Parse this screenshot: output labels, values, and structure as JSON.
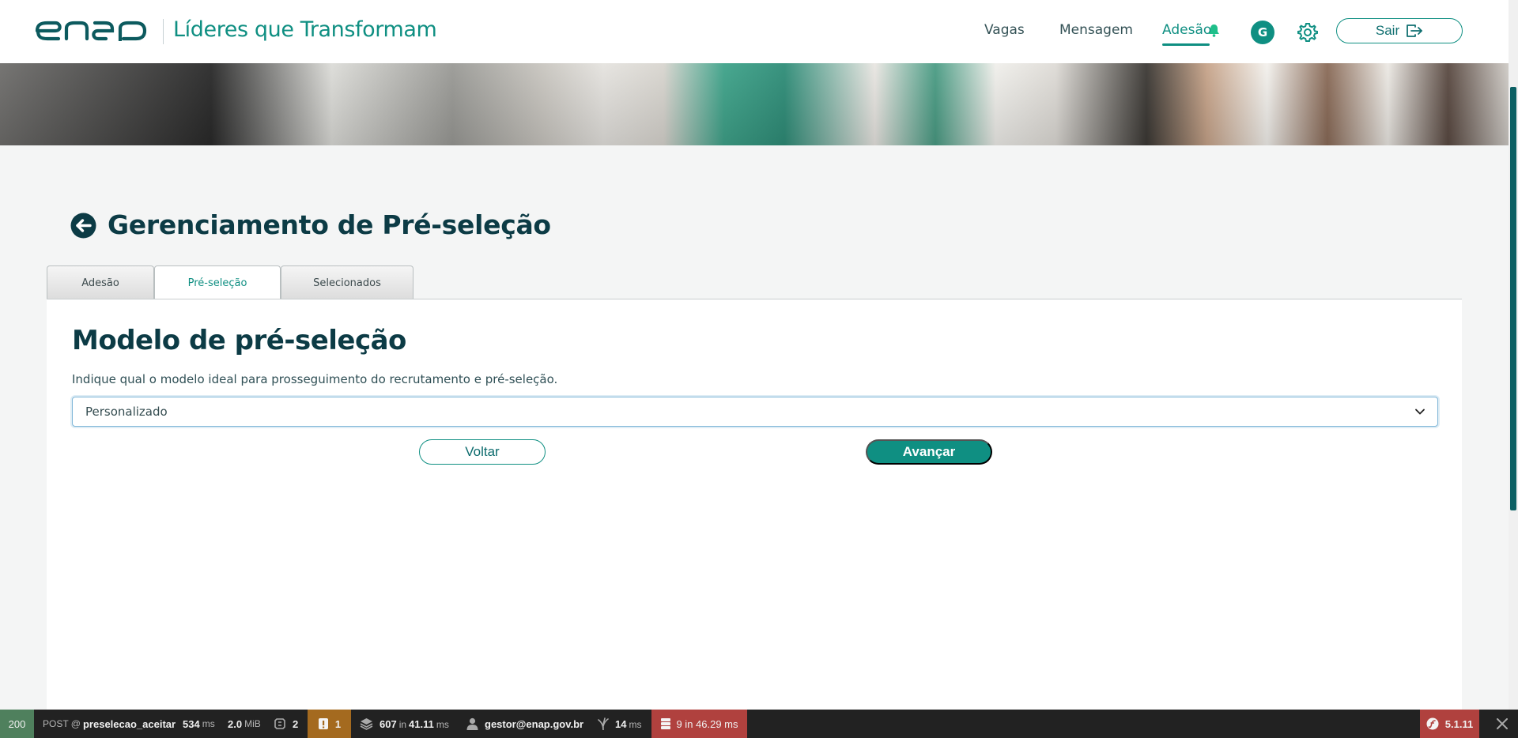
{
  "header": {
    "logo_text": "enap",
    "brand_title": "Líderes que Transformam",
    "nav": [
      {
        "label": "Vagas"
      },
      {
        "label": "Mensagem"
      },
      {
        "label": "Adesão"
      }
    ],
    "avatar_initial": "G",
    "logout_label": "Sair",
    "icons": {
      "bell": "bell-icon",
      "gear": "gear-icon",
      "logout": "logout-icon"
    },
    "accent_color": "#0f8f82"
  },
  "page": {
    "title": "Gerenciamento de Pré-seleção",
    "tabs": [
      {
        "label": "Adesão",
        "active": false
      },
      {
        "label": "Pré-seleção",
        "active": true
      },
      {
        "label": "Selecionados",
        "active": false
      }
    ]
  },
  "panel": {
    "title": "Modelo de pré-seleção",
    "description": "Indique qual o modelo ideal para prosseguimento do recrutamento e pré-seleção.",
    "select": {
      "selected": "Personalizado"
    },
    "back_label": "Voltar",
    "next_label": "Avançar"
  },
  "debug_toolbar": {
    "status": "200",
    "method": "POST @",
    "route": "preselecao_aceitar",
    "time_value": "534",
    "time_unit": "ms",
    "memory_value": "2.0",
    "memory_unit": "MiB",
    "forms_count": "2",
    "log_count": "1",
    "cache_calls": "607",
    "cache_in": "in",
    "cache_time": "41.11",
    "cache_unit": "ms",
    "user": "gestor@enap.gov.br",
    "twig_time": "14",
    "twig_unit": "ms",
    "db_text": "9 in 46.29 ms",
    "symfony_version": "5.1.11",
    "status_color": "#4f805d",
    "error_color": "#b0413e",
    "warning_color": "#a46a1f"
  }
}
